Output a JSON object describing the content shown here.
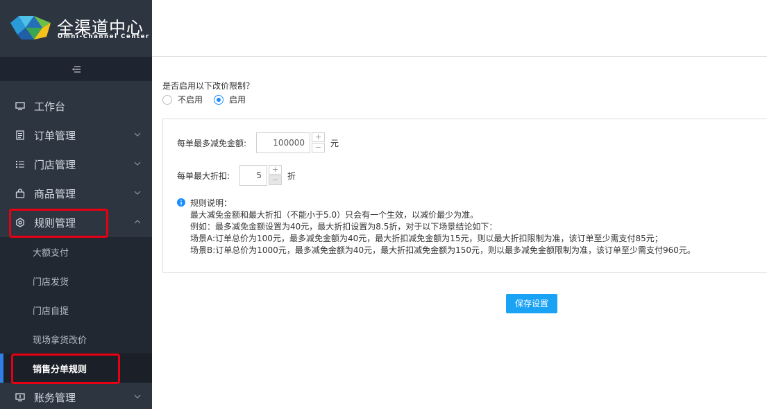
{
  "brand": {
    "title": "全渠道中心",
    "subtitle": "Omni-Channel Center"
  },
  "sidebar": {
    "collapse_icon": "menu-fold-icon",
    "items": [
      {
        "label": "工作台",
        "icon": "monitor-icon"
      },
      {
        "label": "订单管理",
        "icon": "order-icon"
      },
      {
        "label": "门店管理",
        "icon": "list-icon"
      },
      {
        "label": "商品管理",
        "icon": "bag-icon"
      },
      {
        "label": "规则管理",
        "icon": "gear-icon"
      },
      {
        "label": "账务管理",
        "icon": "account-icon"
      }
    ],
    "submenu": [
      {
        "label": "大额支付"
      },
      {
        "label": "门店发货"
      },
      {
        "label": "门店自提"
      },
      {
        "label": "现场拿货改价"
      },
      {
        "label": "销售分单规则"
      }
    ]
  },
  "main": {
    "question": "是否启用以下改价限制？",
    "radio_options": [
      "不启用",
      "启用"
    ],
    "selected_option": "启用",
    "max_discount_amount": {
      "label": "每单最多减免金额:",
      "value": "100000",
      "unit": "元",
      "plus": "+",
      "minus": "−"
    },
    "max_discount_rate": {
      "label": "每单最大折扣:",
      "value": "5",
      "unit": "折",
      "plus": "+",
      "minus": "−"
    },
    "rules": {
      "title": "规则说明：",
      "lines": [
        "最大减免金额和最大折扣（不能小于5.0）只会有一个生效，以减价最少为准。",
        "例如：最多减免金额设置为40元，最大折扣设置为8.5折，对于以下场景结论如下：",
        "场景A:订单总价为100元，最多减免金额为40元，最大折扣减免金额为15元，则以最大折扣限制为准，该订单至少需支付85元；",
        "场景B:订单总价为1000元，最多减免金额为40元，最大折扣减免金额为150元，则以最多减免金额限制为准，该订单至少需支付960元。"
      ]
    },
    "save_label": "保存设置"
  },
  "colors": {
    "sidebar_bg": "#2d3541",
    "accent": "#1aa2f5",
    "highlight": "#e60012",
    "active_indicator": "#2f7fe6"
  }
}
